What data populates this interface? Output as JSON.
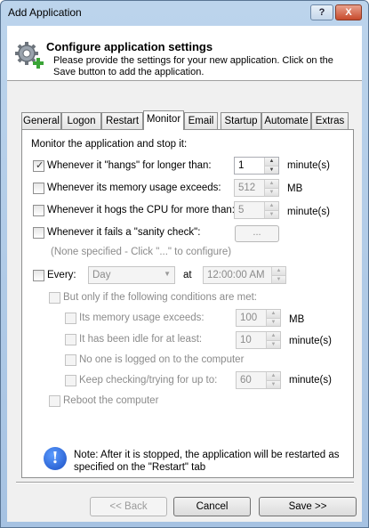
{
  "window": {
    "title": "Add Application",
    "help_label": "?",
    "close_label": "X"
  },
  "header": {
    "title": "Configure application settings",
    "description": "Please provide the settings for your new application. Click on the Save button to add the application."
  },
  "tabs": [
    {
      "label": "General"
    },
    {
      "label": "Logon"
    },
    {
      "label": "Restart"
    },
    {
      "label": "Monitor",
      "active": true
    },
    {
      "label": "Email"
    },
    {
      "label": "Startup"
    },
    {
      "label": "Automate"
    },
    {
      "label": "Extras"
    }
  ],
  "monitor": {
    "section_label": "Monitor the application and stop it:",
    "hangs": {
      "label": "Whenever it \"hangs\" for longer than:",
      "checked": true,
      "value": "1",
      "unit": "minute(s)"
    },
    "memory": {
      "label": "Whenever its memory usage exceeds:",
      "checked": false,
      "value": "512",
      "unit": "MB"
    },
    "cpu": {
      "label": "Whenever it hogs the CPU for more than:",
      "checked": false,
      "value": "5",
      "unit": "minute(s)"
    },
    "sanity": {
      "label": "Whenever it fails a \"sanity check\":",
      "checked": false,
      "button": "...",
      "hint": "(None specified - Click \"...\" to configure)"
    },
    "every": {
      "label": "Every:",
      "checked": false,
      "frequency": "Day",
      "at_label": "at",
      "time": "12:00:00 AM"
    },
    "conditions": {
      "label": "But only if the following conditions are met:",
      "memory": {
        "label": "Its memory usage exceeds:",
        "value": "100",
        "unit": "MB"
      },
      "idle": {
        "label": "It has been idle for at least:",
        "value": "10",
        "unit": "minute(s)"
      },
      "nologon": {
        "label": "No one is logged on to the computer"
      },
      "keep": {
        "label": "Keep checking/trying for up to:",
        "value": "60",
        "unit": "minute(s)"
      }
    },
    "reboot": {
      "label": "Reboot the computer"
    },
    "note": "Note: After it is stopped, the application will be restarted as specified on the \"Restart\" tab"
  },
  "buttons": {
    "back": "<< Back",
    "cancel": "Cancel",
    "save": "Save >>"
  },
  "colors": {
    "title_bar": "#a6c2e2",
    "close_button": "#c74a2c",
    "info_icon": "#1b4fc4"
  }
}
